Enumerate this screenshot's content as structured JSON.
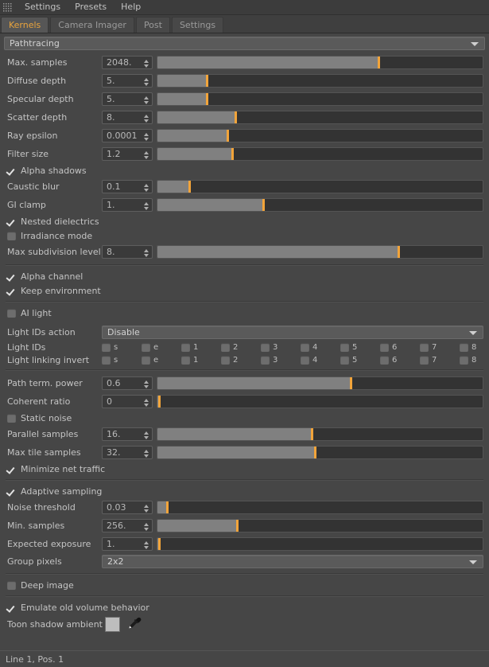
{
  "menubar": {
    "grip_icon": "grip-dots-icon",
    "items": [
      {
        "label": "Settings"
      },
      {
        "label": "Presets"
      },
      {
        "label": "Help"
      }
    ]
  },
  "tabs": [
    {
      "label": "Kernels",
      "active": true
    },
    {
      "label": "Camera Imager",
      "active": false
    },
    {
      "label": "Post",
      "active": false
    },
    {
      "label": "Settings",
      "active": false
    }
  ],
  "kernel_select": {
    "value": "Pathtracing",
    "caret_icon": "chevron-down-icon"
  },
  "params": {
    "max_samples": {
      "label": "Max. samples",
      "value": "2048.",
      "fill": 68.0,
      "knob": 68.0
    },
    "diffuse_depth": {
      "label": "Diffuse depth",
      "value": "5.",
      "fill": 15.2,
      "knob": 15.2
    },
    "specular_depth": {
      "label": "Specular depth",
      "value": "5.",
      "fill": 15.2,
      "knob": 15.2
    },
    "scatter_depth": {
      "label": "Scatter depth",
      "value": "8.",
      "fill": 24.0,
      "knob": 24.0
    },
    "ray_epsilon": {
      "label": "Ray epsilon",
      "value": "0.0001",
      "fill": 21.5,
      "knob": 21.5
    },
    "filter_size": {
      "label": "Filter size",
      "value": "1.2",
      "fill": 23.0,
      "knob": 23.0
    },
    "caustic_blur": {
      "label": "Caustic blur",
      "value": "0.1",
      "fill": 9.7,
      "knob": 9.7
    },
    "gi_clamp": {
      "label": "GI clamp",
      "value": "1.",
      "fill": 32.5,
      "knob": 32.5
    },
    "max_subdivision": {
      "label": "Max subdivision level",
      "value": "8.",
      "fill": 74.0,
      "knob": 74.0
    },
    "path_term_power": {
      "label": "Path term. power",
      "value": "0.6",
      "fill": 59.5,
      "knob": 59.5
    },
    "coherent_ratio": {
      "label": "Coherent ratio",
      "value": "0",
      "fill": 0.4,
      "knob": 0.4
    },
    "parallel_samples": {
      "label": "Parallel samples",
      "value": "16.",
      "fill": 47.5,
      "knob": 47.5
    },
    "max_tile_samples": {
      "label": "Max tile samples",
      "value": "32.",
      "fill": 48.5,
      "knob": 48.5
    },
    "noise_threshold": {
      "label": "Noise threshold",
      "value": "0.03",
      "fill": 3.0,
      "knob": 3.0
    },
    "min_samples": {
      "label": "Min. samples",
      "value": "256.",
      "fill": 24.5,
      "knob": 24.5
    },
    "expected_exposure": {
      "label": "Expected exposure",
      "value": "1.",
      "fill": 0.4,
      "knob": 0.4
    }
  },
  "checkboxes": {
    "alpha_shadows": {
      "label": "Alpha shadows",
      "checked": true
    },
    "nested_dielectrics": {
      "label": "Nested dielectrics",
      "checked": true
    },
    "irradiance_mode": {
      "label": "Irradiance mode",
      "checked": false
    },
    "alpha_channel": {
      "label": "Alpha channel",
      "checked": true
    },
    "keep_environment": {
      "label": "Keep environment",
      "checked": true
    },
    "ai_light": {
      "label": "AI light",
      "checked": false
    },
    "static_noise": {
      "label": "Static noise",
      "checked": false
    },
    "minimize_net_traffic": {
      "label": "Minimize net traffic",
      "checked": true
    },
    "adaptive_sampling": {
      "label": "Adaptive sampling",
      "checked": true
    },
    "deep_image": {
      "label": "Deep image",
      "checked": false
    },
    "emulate_old_volume": {
      "label": "Emulate old volume behavior",
      "checked": true
    }
  },
  "light_ids_action": {
    "label": "Light IDs action",
    "value": "Disable",
    "caret_icon": "chevron-down-icon"
  },
  "light_ids": {
    "label": "Light IDs",
    "cells": [
      {
        "label": "s",
        "checked": false
      },
      {
        "label": "e",
        "checked": false
      },
      {
        "label": "1",
        "checked": false
      },
      {
        "label": "2",
        "checked": false
      },
      {
        "label": "3",
        "checked": false
      },
      {
        "label": "4",
        "checked": false
      },
      {
        "label": "5",
        "checked": false
      },
      {
        "label": "6",
        "checked": false
      },
      {
        "label": "7",
        "checked": false
      },
      {
        "label": "8",
        "checked": false
      }
    ]
  },
  "light_linking_invert": {
    "label": "Light linking invert",
    "cells": [
      {
        "label": "s",
        "checked": false
      },
      {
        "label": "e",
        "checked": false
      },
      {
        "label": "1",
        "checked": false
      },
      {
        "label": "2",
        "checked": false
      },
      {
        "label": "3",
        "checked": false
      },
      {
        "label": "4",
        "checked": false
      },
      {
        "label": "5",
        "checked": false
      },
      {
        "label": "6",
        "checked": false
      },
      {
        "label": "7",
        "checked": false
      },
      {
        "label": "8",
        "checked": false
      }
    ]
  },
  "group_pixels": {
    "label": "Group pixels",
    "value": "2x2",
    "caret_icon": "chevron-down-icon"
  },
  "toon_shadow_ambient": {
    "label": "Toon shadow ambient",
    "swatch_color": "#bdbdbd",
    "picker_icon": "eyedropper-icon"
  },
  "statusbar": {
    "text": "Line 1, Pos. 1"
  },
  "colors": {
    "accent": "#e8a33d",
    "slider_knob": "#f2a43a",
    "slider_fill": "#808080",
    "panel_bg": "#464646",
    "track_bg": "#333333"
  }
}
